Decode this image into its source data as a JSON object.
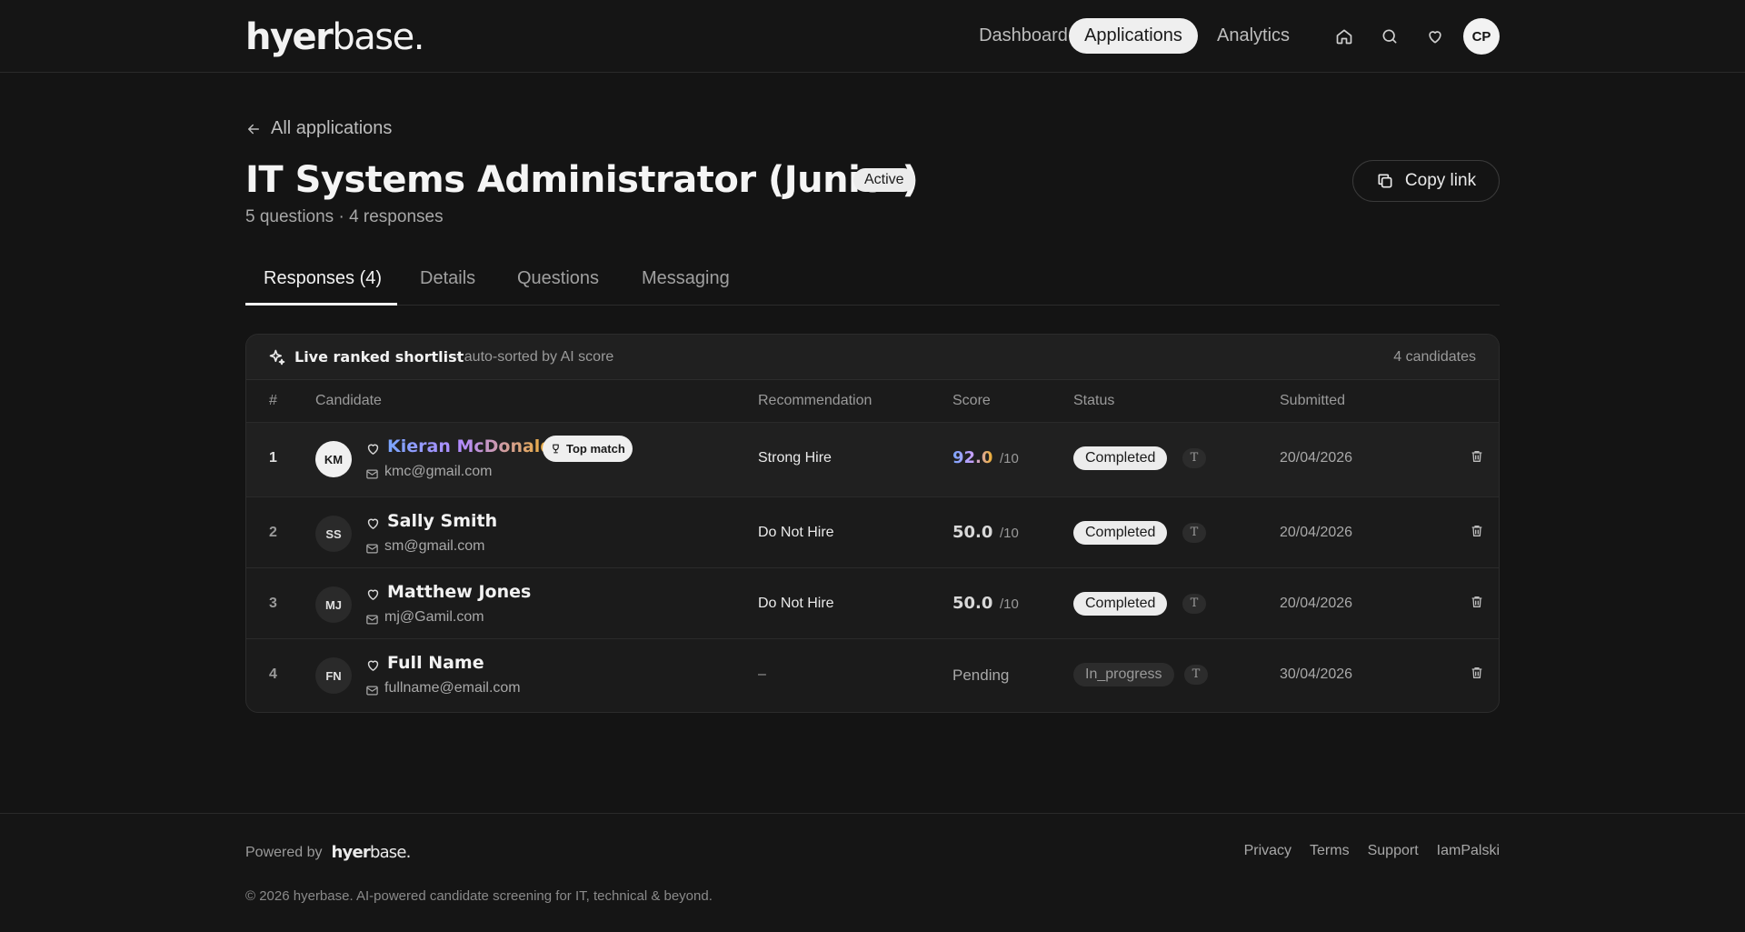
{
  "brand": {
    "logo_bold": "hyer",
    "logo_light": "base."
  },
  "nav": {
    "dashboard": "Dashboard",
    "applications": "Applications",
    "analytics": "Analytics",
    "avatar": "CP"
  },
  "page": {
    "back_label": "All applications",
    "title": "IT Systems Administrator (Junior)",
    "status_badge": "Active",
    "subtitle": "5 questions · 4 responses",
    "copy_link": "Copy link"
  },
  "tabs": [
    {
      "label": "Responses (4)",
      "active": true
    },
    {
      "label": "Details"
    },
    {
      "label": "Questions"
    },
    {
      "label": "Messaging"
    }
  ],
  "shortlist": {
    "title": "Live ranked shortlist",
    "desc": "· auto-sorted by AI score",
    "count": "4 candidates",
    "columns": {
      "rank": "#",
      "candidate": "Candidate",
      "recommendation": "Recommendation",
      "score": "Score",
      "status": "Status",
      "submitted": "Submitted"
    },
    "top_match": "Top match",
    "rows": [
      {
        "rank": "1",
        "initials": "KM",
        "name": "Kieran McDonald",
        "email": "kmc@gmail.com",
        "recommendation": "Strong Hire",
        "score": "92.0",
        "score_suffix": "/10",
        "status": "Completed",
        "type_badge": "T",
        "submitted": "20/04/2026"
      },
      {
        "rank": "2",
        "initials": "SS",
        "name": "Sally Smith",
        "email": "sm@gmail.com",
        "recommendation": "Do Not Hire",
        "score": "50.0",
        "score_suffix": "/10",
        "status": "Completed",
        "type_badge": "T",
        "submitted": "20/04/2026"
      },
      {
        "rank": "3",
        "initials": "MJ",
        "name": "Matthew Jones",
        "email": "mj@Gamil.com",
        "recommendation": "Do Not Hire",
        "score": "50.0",
        "score_suffix": "/10",
        "status": "Completed",
        "type_badge": "T",
        "submitted": "20/04/2026"
      },
      {
        "rank": "4",
        "initials": "FN",
        "name": "Full Name",
        "email": "fullname@email.com",
        "recommendation": "–",
        "score": "Pending",
        "status": "In_progress",
        "type_badge": "T",
        "submitted": "30/04/2026"
      }
    ]
  },
  "footer": {
    "powered_by": "Powered by",
    "links": [
      "Privacy",
      "Terms",
      "Support",
      "IamPalski"
    ],
    "copyright": "© 2026 hyerbase. AI-powered candidate screening for IT, technical & beyond."
  },
  "colors": {
    "background": "#141414",
    "panel": "#1b1b1b",
    "accent_gradient_start": "#7aa6ff",
    "accent_gradient_mid": "#b48bff",
    "accent_gradient_end": "#f0b030"
  }
}
